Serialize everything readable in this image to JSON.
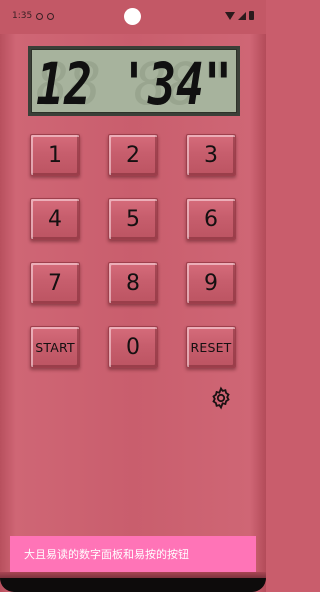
{
  "status_bar": {
    "time": "1:35"
  },
  "display": {
    "ghost": "88 88\"",
    "value": "12 '34\""
  },
  "keypad": {
    "k1": "1",
    "k2": "2",
    "k3": "3",
    "k4": "4",
    "k5": "5",
    "k6": "6",
    "k7": "7",
    "k8": "8",
    "k9": "9",
    "start": "START",
    "k0": "0",
    "reset": "RESET"
  },
  "toast": {
    "text": "大且易读的数字面板和易按的按钮"
  },
  "icons": {
    "settings": "gear-icon"
  },
  "colors": {
    "background": "#c95d6c",
    "lcd": "#a7b39d",
    "toast": "#ff74b7"
  }
}
